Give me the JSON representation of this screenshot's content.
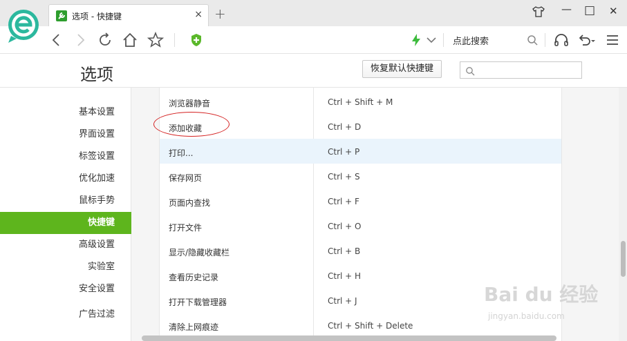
{
  "window": {
    "tab_title": "选项 - 快捷键",
    "tab_close": "×",
    "new_tab": "+",
    "controls": {
      "shirt_icon": "shirt-icon",
      "minimize": "—",
      "maximize": "□",
      "close": "✕"
    }
  },
  "navbar": {
    "search_hint": "点此搜索",
    "icons": [
      "back-icon",
      "forward-icon",
      "refresh-icon",
      "home-icon",
      "star-icon",
      "shield-icon",
      "lightning-icon",
      "search-icon",
      "headphones-icon",
      "undo-icon",
      "menu-icon"
    ]
  },
  "header": {
    "title": "选项",
    "restore_button": "恢复默认快捷键",
    "search_placeholder": ""
  },
  "sidebar": {
    "items": [
      {
        "label": "基本设置"
      },
      {
        "label": "界面设置"
      },
      {
        "label": "标签设置"
      },
      {
        "label": "优化加速"
      },
      {
        "label": "鼠标手势"
      },
      {
        "label": "快捷键",
        "active": true
      },
      {
        "label": "高级设置"
      },
      {
        "label": "实验室"
      },
      {
        "label": "安全设置"
      },
      {
        "label": "广告过滤"
      }
    ]
  },
  "shortcuts": [
    {
      "name": "浏览器静音",
      "keys": "Ctrl + Shift + M"
    },
    {
      "name": "添加收藏",
      "keys": "Ctrl + D"
    },
    {
      "name": "打印...",
      "keys": "Ctrl + P",
      "highlighted": true
    },
    {
      "name": "保存网页",
      "keys": "Ctrl + S"
    },
    {
      "name": "页面内查找",
      "keys": "Ctrl + F"
    },
    {
      "name": "打开文件",
      "keys": "Ctrl + O"
    },
    {
      "name": "显示/隐藏收藏栏",
      "keys": "Ctrl + B"
    },
    {
      "name": "查看历史记录",
      "keys": "Ctrl + H"
    },
    {
      "name": "打开下载管理器",
      "keys": "Ctrl + J"
    },
    {
      "name": "清除上网痕迹",
      "keys": "Ctrl + Shift + Delete"
    }
  ],
  "watermark": {
    "text": "Bai du 经验",
    "sub": "jingyan.baidu.com"
  },
  "colors": {
    "accent": "#5eb51d",
    "highlight_row": "#eaf4fc",
    "annotation": "#d42020"
  }
}
